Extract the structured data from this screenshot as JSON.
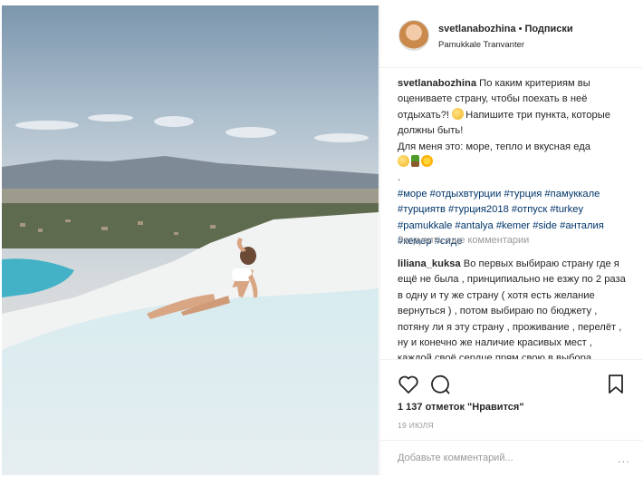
{
  "post": {
    "username": "svetlanabozhina",
    "separator": "•",
    "follow_label": "Подписки",
    "location": "Pamukkale Tranvanter"
  },
  "caption": {
    "username": "svetlanabozhina",
    "text_1": "По каким критериям вы оцениваете страну, чтобы поехать в неё отдыхать?!",
    "text_2": "Напишите три пункта, которые должны быть!",
    "text_3": "Для меня это: море, тепло и вкусная еда",
    "dot": ".",
    "hashtags": "#море #отдыхвтурции #турция #памуккале #турциятв #турция2018 #отпуск #turkey #pamukkale #antalya #kemer #side #анталия #кемер #сиде"
  },
  "load_more_label": "Загрузить еще комментарии",
  "comment": {
    "username": "liliana_kuksa",
    "text": "Во первых выбираю страну где я ещё не была , принципиально не езжу по 2 раза в одну и ту же страну ( хотя есть желание вернуться ) , потом выбираю по бюджету , потяну ли я эту страну , проживание , перелёт , ну и конечно же наличие красивых мест , каждой своё сердце прям свою в выбора"
  },
  "actions": {
    "like_icon": "heart-icon",
    "comment_icon": "comment-icon",
    "save_icon": "bookmark-icon"
  },
  "likes_text": "1 137 отметок \"Нравится\"",
  "date_text": "19 ИЮЛЯ",
  "add_comment_placeholder": "Добавьте комментарий...",
  "more_options": "...",
  "colors": {
    "hashtag": "#003569",
    "muted": "#999999",
    "border": "#efefef"
  }
}
